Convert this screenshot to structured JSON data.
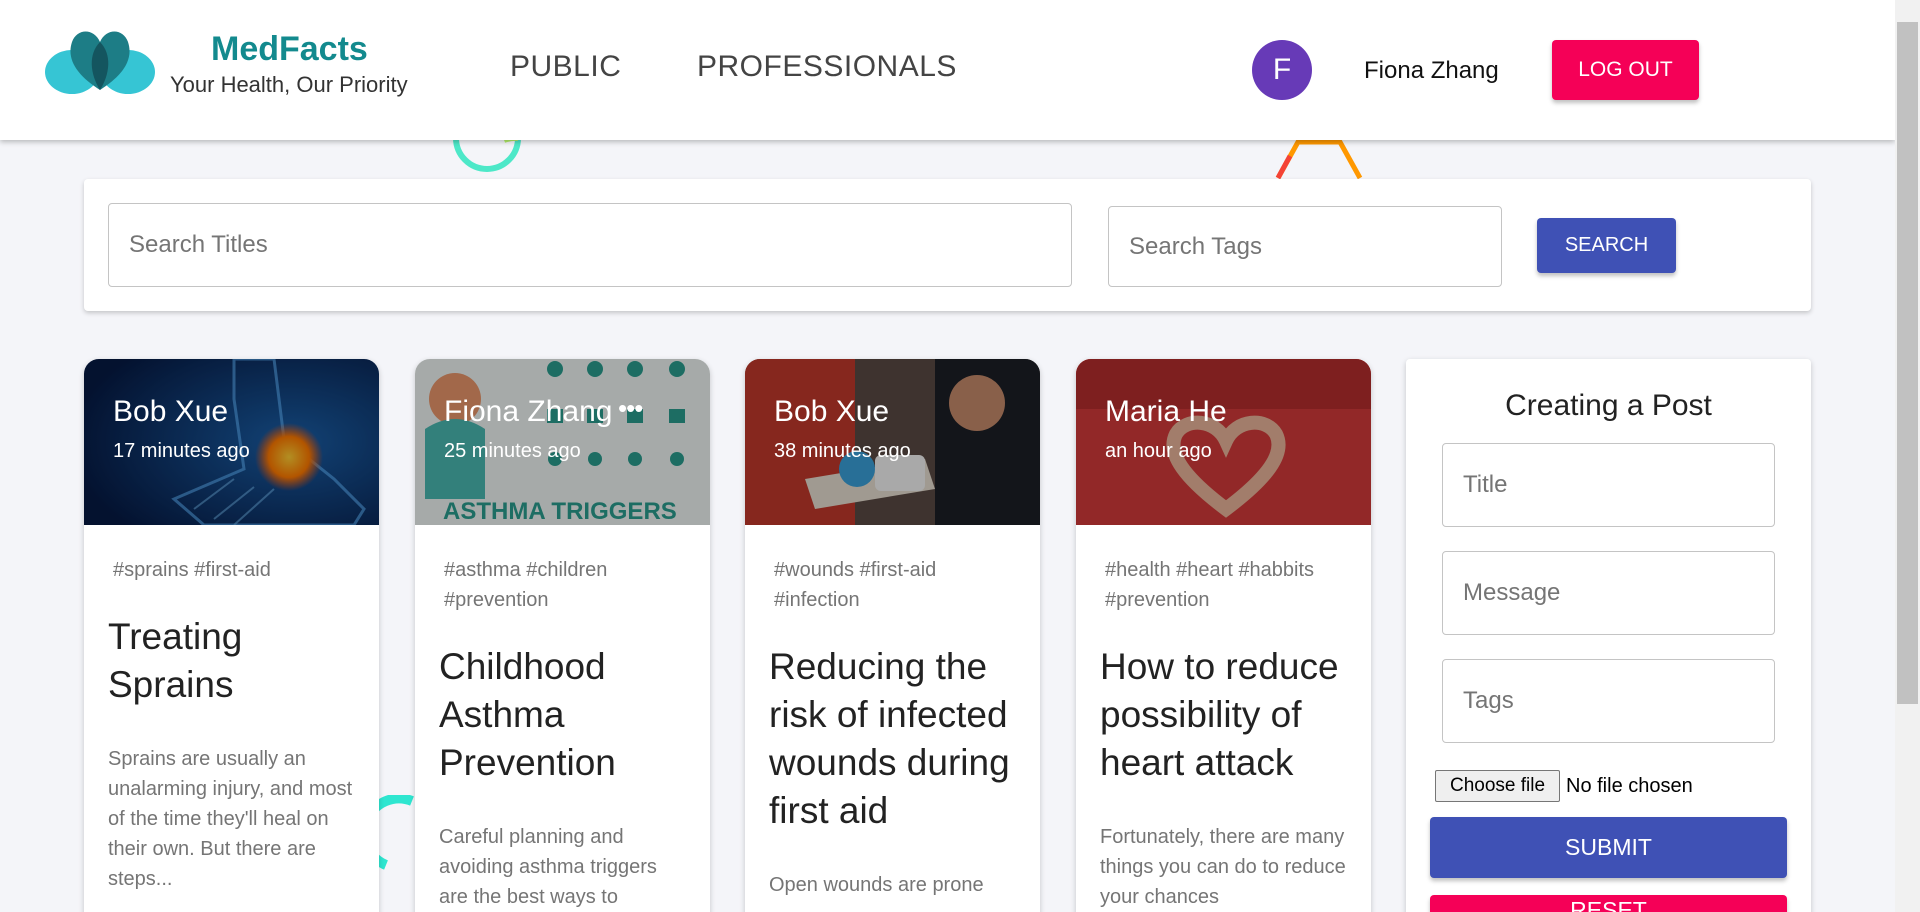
{
  "header": {
    "brand_name": "MedFacts",
    "brand_tagline": "Your Health, Our Priority",
    "nav": [
      "PUBLIC",
      "PROFESSIONALS"
    ],
    "avatar_initial": "F",
    "user_name": "Fiona Zhang",
    "logout_label": "LOG OUT"
  },
  "search": {
    "titles_placeholder": "Search Titles",
    "tags_placeholder": "Search Tags",
    "button_label": "SEARCH"
  },
  "posts": [
    {
      "author": "Bob Xue",
      "time": "17 minutes ago",
      "tags": "#sprains #first-aid",
      "title": "Treating Sprains",
      "body": "Sprains are usually an unalarming injury, and most of the time they'll heal on their own. But there are steps..."
    },
    {
      "author": "Fiona Zhang",
      "time": "25 minutes ago",
      "more": "•••",
      "image_text": "ASTHMA TRIGGERS",
      "tags": "#asthma #children #prevention",
      "title": "Childhood Asthma Prevention",
      "body": "Careful planning and avoiding asthma triggers are the best ways to"
    },
    {
      "author": "Bob Xue",
      "time": "38 minutes ago",
      "tags": "#wounds #first-aid #infection",
      "title": "Reducing the risk of infected wounds during first aid",
      "body": "Open wounds are prone"
    },
    {
      "author": "Maria He",
      "time": "an hour ago",
      "tags": "#health #heart #habbits #prevention",
      "title": "How to reduce possibility of heart attack",
      "body": "Fortunately, there are many things you can do to reduce your chances"
    }
  ],
  "form": {
    "heading": "Creating a Post",
    "title_placeholder": "Title",
    "message_placeholder": "Message",
    "tags_placeholder": "Tags",
    "file_button": "Choose file",
    "file_status": "No file chosen",
    "submit_label": "SUBMIT",
    "reset_label": "RESET"
  },
  "colors": {
    "primary": "#3f51b5",
    "secondary": "#f50057",
    "brand": "#138a8e",
    "avatar": "#673ab7"
  }
}
